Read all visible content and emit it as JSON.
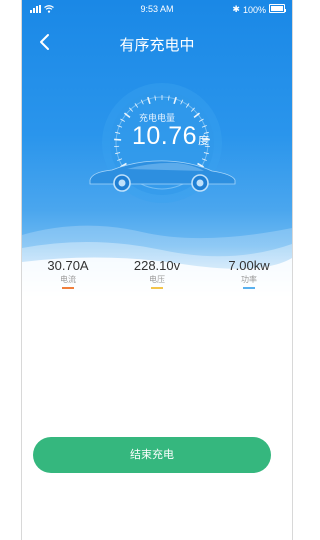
{
  "status_bar": {
    "time": "9:53 AM",
    "battery": "100%"
  },
  "header": {
    "title": "有序充电中"
  },
  "gauge": {
    "label": "充电电量",
    "value": "10.76",
    "unit": "度"
  },
  "stats": [
    {
      "value": "30.70A",
      "label": "电流",
      "color": "#f07f3c"
    },
    {
      "value": "228.10v",
      "label": "电压",
      "color": "#f2c44b"
    },
    {
      "value": "7.00kw",
      "label": "功率",
      "color": "#58b0ee"
    }
  ],
  "actions": {
    "end_label": "结束充电"
  },
  "colors": {
    "primary": "#1a88e6",
    "button": "#35b77e"
  }
}
